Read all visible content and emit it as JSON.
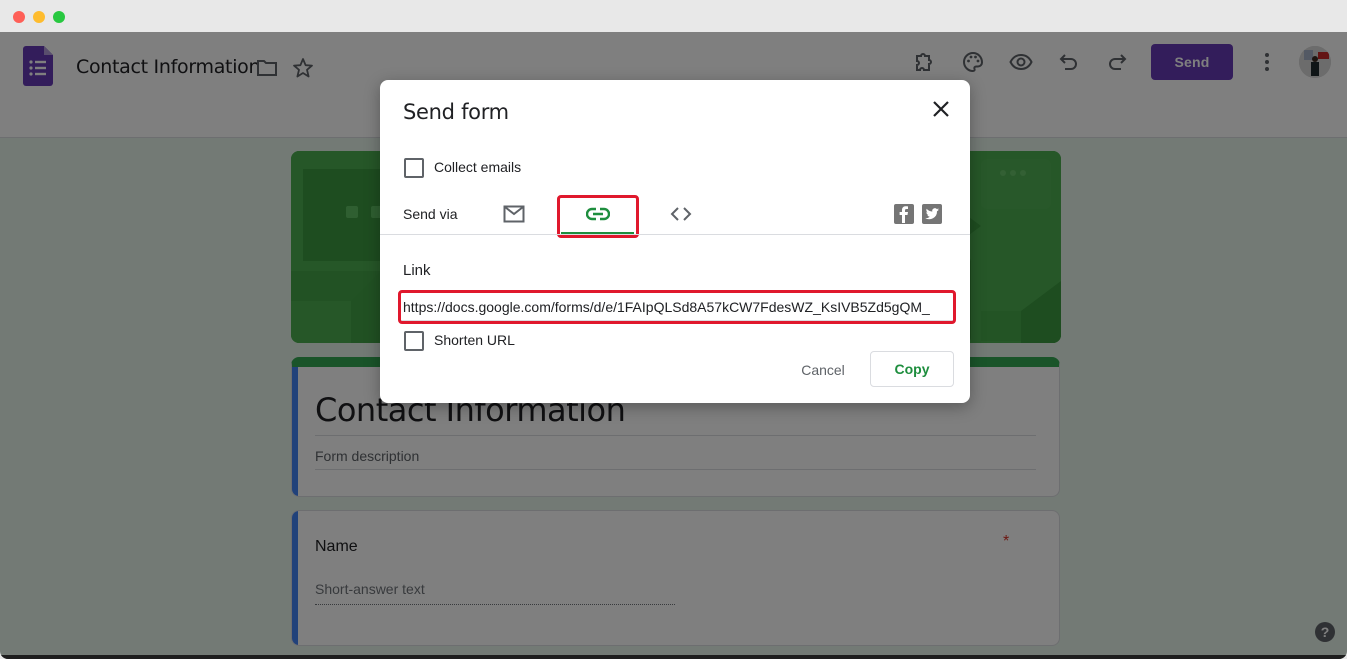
{
  "window": {
    "traffic_lights": [
      "close",
      "minimize",
      "maximize"
    ]
  },
  "appbar": {
    "logo_icon": "google-forms-icon",
    "doc_title": "Contact Information",
    "folder_icon": "folder-icon",
    "star_icon": "star-icon",
    "actions": [
      {
        "name": "addons",
        "icon": "puzzle-icon"
      },
      {
        "name": "customize-theme",
        "icon": "palette-icon"
      },
      {
        "name": "preview",
        "icon": "eye-icon"
      },
      {
        "name": "undo",
        "icon": "undo-icon"
      },
      {
        "name": "redo",
        "icon": "redo-icon"
      }
    ],
    "send_label": "Send",
    "more_icon": "more-vert-icon",
    "brand_color": "#673ab7"
  },
  "form": {
    "title": "Contact Information",
    "description_placeholder": "Form description",
    "questions": [
      {
        "title": "Name",
        "required_marker": "*",
        "answer_placeholder": "Short-answer text"
      }
    ],
    "theme_color": "#34a853"
  },
  "help": {
    "label": "?"
  },
  "dialog": {
    "title": "Send form",
    "close_icon": "close-icon",
    "collect_emails_label": "Collect emails",
    "collect_emails_checked": false,
    "send_via_label": "Send via",
    "tabs": [
      {
        "name": "email",
        "icon": "mail-icon",
        "selected": false
      },
      {
        "name": "link",
        "icon": "link-icon",
        "selected": true
      },
      {
        "name": "embed",
        "icon": "code-icon",
        "selected": false
      }
    ],
    "social": [
      {
        "name": "facebook",
        "icon": "facebook-icon",
        "glyph": "f"
      },
      {
        "name": "twitter",
        "icon": "twitter-icon"
      }
    ],
    "link_label": "Link",
    "link_value": "https://docs.google.com/forms/d/e/1FAIpQLSd8A57kCW7FdesWZ_KsIVB5Zd5gQM_",
    "shorten_url_label": "Shorten URL",
    "shorten_url_checked": false,
    "cancel_label": "Cancel",
    "copy_label": "Copy",
    "accent_color": "#1e8e3e",
    "highlight_color": "#e0182d"
  }
}
